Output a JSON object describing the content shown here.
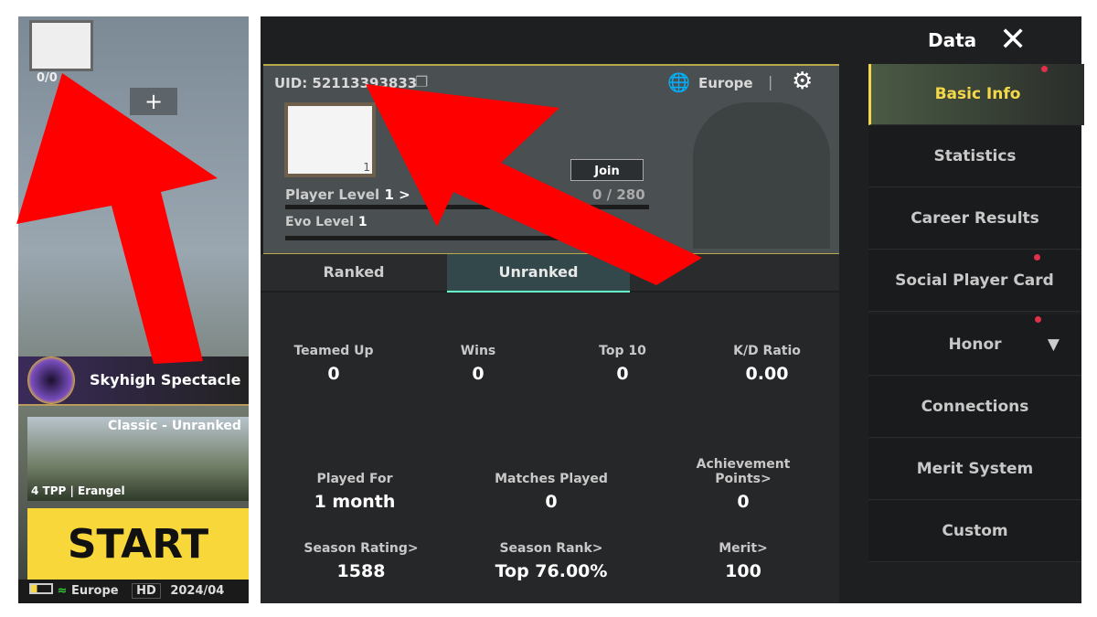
{
  "left_panel": {
    "level_text": "0/0",
    "event": "Skyhigh Spectacle",
    "mode": "Classic - Unranked",
    "mode_sub": "4 TPP | Erangel",
    "start_label": "START",
    "status": {
      "region": "Europe",
      "quality": "HD",
      "date": "2024/04"
    }
  },
  "header": {
    "title": "Data"
  },
  "profile": {
    "uid": "UID: 52113393833",
    "region": "Europe",
    "avatar_level": "1",
    "join_label": "Join",
    "player_level_label": "Player Level",
    "player_level": "1",
    "player_level_arrow": ">",
    "xp": "0 / 280",
    "evo_level_label": "Evo Level",
    "evo_level": "1",
    "xp_fraction": 0
  },
  "tabs": [
    {
      "label": "Ranked",
      "active": false
    },
    {
      "label": "Unranked",
      "active": true
    }
  ],
  "stats": [
    {
      "label": "Teamed Up",
      "value": "0"
    },
    {
      "label": "Wins",
      "value": "0"
    },
    {
      "label": "Top 10",
      "value": "0"
    },
    {
      "label": "K/D Ratio",
      "value": "0.00"
    },
    {
      "label": "Played For",
      "value": "1 month"
    },
    {
      "label": "Matches Played",
      "value": "0"
    },
    {
      "label": "Achievement Points>",
      "value": "0"
    },
    {
      "label": "Season Rating>",
      "value": "1588"
    },
    {
      "label": "Season Rank>",
      "value": "Top 76.00%"
    },
    {
      "label": "Merit>",
      "value": "100"
    }
  ],
  "sidebar": [
    {
      "label": "Basic Info",
      "active": true
    },
    {
      "label": "Statistics"
    },
    {
      "label": "Career Results"
    },
    {
      "label": "Social Player Card"
    },
    {
      "label": "Honor"
    },
    {
      "label": "Connections"
    },
    {
      "label": "Merit System"
    },
    {
      "label": "Custom"
    }
  ],
  "colors": {
    "accent": "#f5d84a",
    "start": "#f7d73a",
    "arrow": "#ff0000"
  }
}
